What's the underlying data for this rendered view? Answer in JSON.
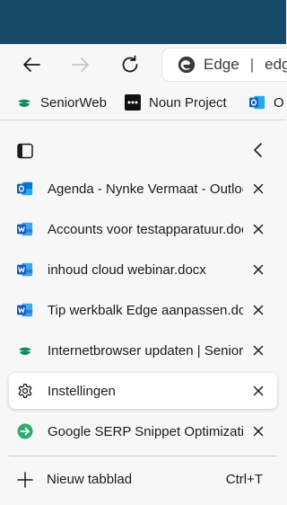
{
  "toolbar": {
    "address_site": "Edge",
    "address_separator": "|",
    "address_url": "edg"
  },
  "favorites": [
    {
      "label": "SeniorWeb",
      "icon": "seniorweb-icon"
    },
    {
      "label": "Noun Project",
      "icon": "noun-project-icon"
    },
    {
      "label": "O",
      "icon": "outlook-icon"
    }
  ],
  "tabs": [
    {
      "label": "Agenda - Nynke Vermaat - Outlook",
      "icon": "outlook-icon",
      "active": false
    },
    {
      "label": "Accounts voor testapparatuur.docx",
      "icon": "word-icon",
      "active": false
    },
    {
      "label": "inhoud cloud webinar.docx",
      "icon": "word-icon",
      "active": false
    },
    {
      "label": "Tip werkbalk Edge aanpassen.docx",
      "icon": "word-icon",
      "active": false
    },
    {
      "label": "Internetbrowser updaten | SeniorWeb",
      "icon": "seniorweb-icon",
      "active": false
    },
    {
      "label": "Instellingen",
      "icon": "gear-icon",
      "active": true
    },
    {
      "label": "Google SERP Snippet Optimization",
      "icon": "serp-tool-icon",
      "active": false
    }
  ],
  "new_tab": {
    "label": "Nieuw tabblad",
    "shortcut": "Ctrl+T"
  },
  "colors": {
    "titlebar": "#174a66",
    "outlook_blue": "#0a64c2",
    "word_blue": "#185abd",
    "seniorweb_green": "#0f8a5f",
    "serp_green": "#2eaa6e"
  }
}
